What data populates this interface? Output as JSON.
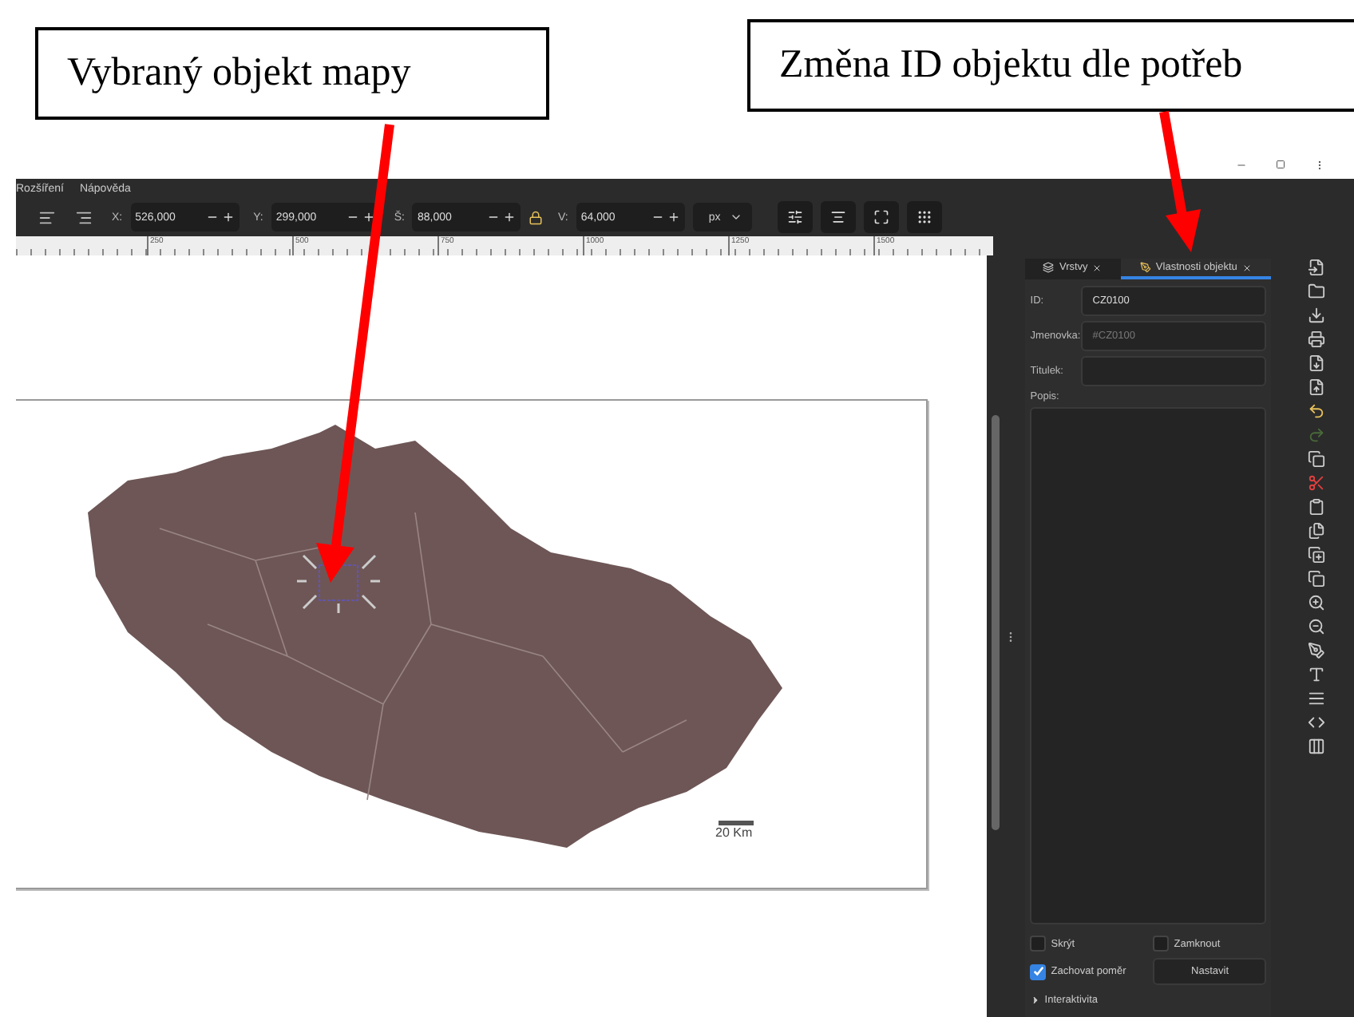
{
  "annotations": [
    {
      "text": "Vybraný objekt mapy"
    },
    {
      "text": "Změna ID objektu dle potřeb"
    }
  ],
  "menu": [
    "Rozšíření",
    "Nápověda"
  ],
  "toolbar": {
    "fields": [
      {
        "label": "X:",
        "value": "526,000"
      },
      {
        "label": "Y:",
        "value": "299,000"
      },
      {
        "label": "Š:",
        "value": "88,000"
      },
      {
        "label": "V:",
        "value": "64,000"
      }
    ],
    "unit": "px"
  },
  "ruler": {
    "ticks": [
      "250",
      "500",
      "750",
      "1000",
      "1250",
      "1500"
    ]
  },
  "canvas": {
    "scale_label": "20 Km"
  },
  "panel": {
    "tabs": [
      {
        "label": "Vrstvy",
        "selected": false
      },
      {
        "label": "Vlastnosti objektu",
        "selected": true
      }
    ],
    "fields": [
      {
        "label": "ID:",
        "value": "CZ0100"
      },
      {
        "label": "Jmenovka:",
        "placeholder": "#CZ0100"
      },
      {
        "label": "Titulek:"
      }
    ],
    "description_label": "Popis:",
    "checkboxes": [
      {
        "label": "Skrýt",
        "checked": false
      },
      {
        "label": "Zamknout",
        "checked": false
      },
      {
        "label": "Zachovat poměr",
        "checked": true
      }
    ],
    "set_button": "Nastavit",
    "expander": {
      "label": "Interaktivita",
      "expanded": false
    }
  }
}
